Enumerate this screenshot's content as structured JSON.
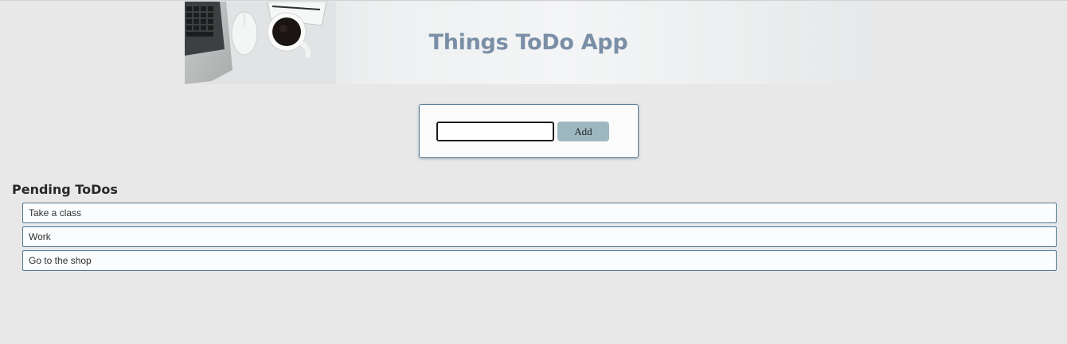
{
  "header": {
    "title": "Things ToDo App"
  },
  "add_form": {
    "input_value": "",
    "button_label": "Add"
  },
  "pending": {
    "heading": "Pending ToDos",
    "items": [
      {
        "label": "Take a class"
      },
      {
        "label": "Work"
      },
      {
        "label": "Go to the shop"
      }
    ]
  },
  "colors": {
    "title": "#7a8fa6",
    "button_bg": "#9db7be",
    "item_border": "#4f7994",
    "page_bg": "#e8e8e9"
  }
}
